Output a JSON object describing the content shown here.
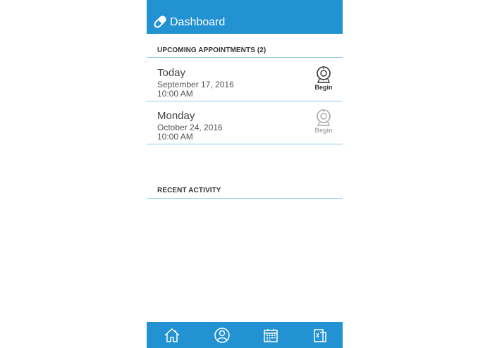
{
  "header": {
    "title": "Dashboard",
    "icon": "pill-icon"
  },
  "upcoming": {
    "title": "UPCOMING APPOINTMENTS (2)",
    "items": [
      {
        "day": "Today",
        "date": "September 17, 2016",
        "time": "10:00 AM",
        "action": "Begin",
        "active": true
      },
      {
        "day": "Monday",
        "date": "October 24, 2016",
        "time": "10:00 AM",
        "action": "Begin",
        "active": false
      }
    ]
  },
  "recent": {
    "title": "RECENT ACTIVITY"
  },
  "tabbar": {
    "items": [
      {
        "icon": "home-icon"
      },
      {
        "icon": "profile-icon"
      },
      {
        "icon": "calendar-icon"
      },
      {
        "icon": "prescription-icon"
      }
    ]
  },
  "colors": {
    "brand": "#2392d3",
    "divider": "#8cc9ea",
    "active": "#333333",
    "inactive": "#aaaaaa"
  }
}
